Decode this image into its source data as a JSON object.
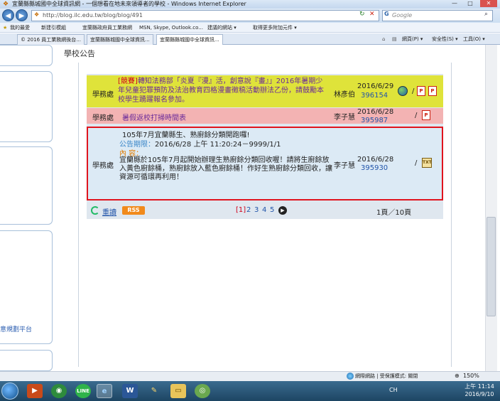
{
  "window": {
    "title": "宜蘭縣縣城國中全球資訊網 - 一個想看在地未來領導者的學校 - Windows Internet Explorer",
    "minimize": "—",
    "maximize": "□",
    "close": "✕"
  },
  "address": {
    "url": "http://blog.ilc.edu.tw/blog/blog/491",
    "search_placeholder": "Google"
  },
  "favorites": {
    "label": "我的最愛",
    "items": [
      "新建引模組",
      "宜蘭縣政府員工業務網",
      "MSN, Skype, Outlook.co...",
      "建議的網站 ▾",
      "取得更多附加元件 ▾"
    ]
  },
  "tabs": [
    "© 2016 員工業務網後台...",
    "宜蘭縣縣城國中全球資訊...",
    "宜蘭縣縣城國中全球資訊..."
  ],
  "toolbar": [
    "網頁(P) ▾",
    "安全性(S) ▾",
    "工具(O) ▾"
  ],
  "page": {
    "heading": "學校公告",
    "sidebar_text": "意規劃平台"
  },
  "rows": [
    {
      "dept": "學務處",
      "tag": "[競賽]",
      "title": "轉知法務部「炎夏『漫』活，創意說『畫』」2016年暑期少年兒童犯罪預防及法治教育四格漫畫徵稿活動辦法乙份，請鼓勵本校學生踴躍報名參加。",
      "author": "林彥伯",
      "date": "2016/6/29",
      "number": "396154",
      "slash": "/"
    },
    {
      "dept": "學務處",
      "title": "暑假返校打掃時間表",
      "author": "李子慧",
      "date": "2016/6/28",
      "number": "395987",
      "slash": "/"
    },
    {
      "dept": "學務處",
      "title": "105年7月宜蘭縣生、熟廚餘分類開跑囉!",
      "period_label": "公告期限：",
      "period": "2016/6/28 上午 11:20:24－9999/1/1",
      "content_label": "內 容：",
      "content": "宜蘭縣於105年7月起開始辦理生熟廚餘分類回收喔！請將生廚餘放入黃色廚餘桶，熟廚餘放入藍色廚餘桶！作好生熟廚餘分類回收，讓資源可循環再利用！",
      "author": "李子慧",
      "date": "2016/6/28",
      "number": "395930",
      "slash": "/"
    }
  ],
  "footer": {
    "reload": "重讀",
    "rss": "RSS",
    "pages": [
      "[1]",
      "2",
      "3",
      "4",
      "5"
    ],
    "page_info": "1頁／10頁"
  },
  "status": {
    "text": "網際網路 | 受保護模式: 關閉",
    "zoom": "150%"
  },
  "taskbar": {
    "tray": "CH",
    "time": "上午 11:14",
    "date": "2016/9/10"
  }
}
